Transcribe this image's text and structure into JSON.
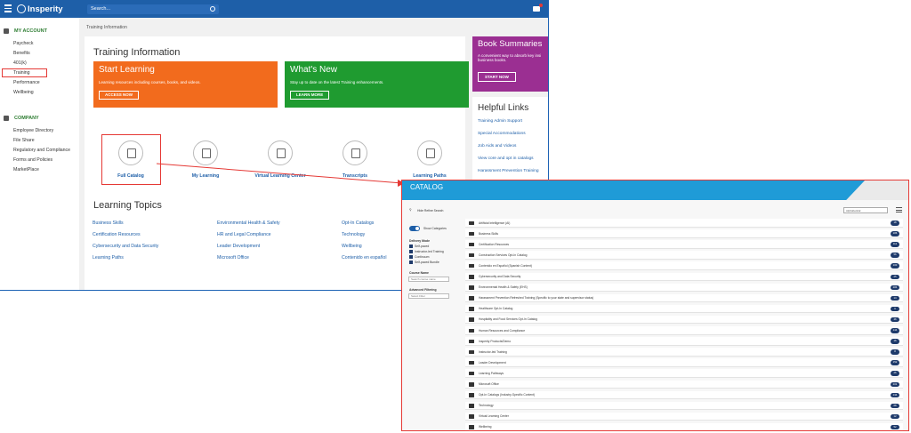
{
  "header": {
    "brand": "Insperity",
    "search_placeholder": "Search..."
  },
  "sidebar": {
    "my_account_title": "MY ACCOUNT",
    "my_account_items": [
      "Paycheck",
      "Benefits",
      "401(k)",
      "Training",
      "Performance",
      "Wellbeing"
    ],
    "company_title": "COMPANY",
    "company_items": [
      "Employee Directory",
      "File Share",
      "Regulatory and Compliance",
      "Forms and Policies",
      "MarketPlace"
    ]
  },
  "breadcrumb": "Training Information",
  "training": {
    "title": "Training Information",
    "start": {
      "title": "Start Learning",
      "desc": "Learning resources including courses, books, and videos.",
      "button": "ACCESS NOW"
    },
    "whats_new": {
      "title": "What's New",
      "desc": "Stay up to date on the latest Training enhancements.",
      "button": "LEARN MORE"
    },
    "quick_links": [
      "Full Catalog",
      "My Learning",
      "Virtual Learning Center",
      "Transcripts",
      "Learning Paths"
    ]
  },
  "book_summaries": {
    "title": "Book Summaries",
    "desc": "A convenient way to absorb key insi business books.",
    "button": "START NOW"
  },
  "helpful_links": {
    "title": "Helpful Links",
    "items": [
      "Training Admin Support",
      "Special Accommodations",
      "Job Aids and Videos",
      "View core and opt in catalogs",
      "Harassment Prevention Training"
    ]
  },
  "learning_topics": {
    "title": "Learning Topics",
    "col1": [
      "Business Skills",
      "Certification Resources",
      "Cybersecurity and Data Security",
      "Learning Paths"
    ],
    "col2": [
      "Environmental Health & Safety",
      "HR and Legal Compliance",
      "Leader Development",
      "Microsoft Office"
    ],
    "col3": [
      "Opt-In Catalogs",
      "Technology",
      "Wellbeing",
      "Contenido en español"
    ]
  },
  "catalog": {
    "title": "CATALOG",
    "hide_refine": "Hide Refine Search",
    "show_categories": "Show Categories",
    "delivery_mode_title": "Delivery Mode",
    "delivery_modes": [
      "Self-paced",
      "Instructor-led Training",
      "Continuum",
      "Self-paced Bundle"
    ],
    "course_name_title": "Course Name",
    "course_name_placeholder": "Search course name",
    "advanced_title": "Advanced Filtering",
    "advanced_value": "Select Filter",
    "sort_value": "Alphabetical",
    "categories": [
      {
        "name": "Artificial Intelligence (AI)",
        "count": "18"
      },
      {
        "name": "Business Skills",
        "count": "186"
      },
      {
        "name": "Certification Resources",
        "count": "112"
      },
      {
        "name": "Construction Services Opt-In Catalog",
        "count": "56"
      },
      {
        "name": "Contenido en Español (Spanish Content)",
        "count": "100"
      },
      {
        "name": "Cybersecurity and Data Security",
        "count": "25"
      },
      {
        "name": "Environmental Health & Safety (EHS)",
        "count": "284"
      },
      {
        "name": "Harassment Prevention Refreshed Training (Specific to your state and supervisor status)",
        "count": "14"
      },
      {
        "name": "Healthcare Opt-In Catalog",
        "count": "6"
      },
      {
        "name": "Hospitality and Food Services Opt-In Catalog",
        "count": "46"
      },
      {
        "name": "Human Resources and Compliance",
        "count": "144"
      },
      {
        "name": "Insperity Products/Demo",
        "count": "16"
      },
      {
        "name": "Instructor-led Training",
        "count": "8"
      },
      {
        "name": "Leader Development",
        "count": "152"
      },
      {
        "name": "Learning Pathways",
        "count": "26"
      },
      {
        "name": "Microsoft Office",
        "count": "201"
      },
      {
        "name": "Opt-In Catalogs (Industry-Specific Content)",
        "count": "134"
      },
      {
        "name": "Technology",
        "count": "68"
      },
      {
        "name": "Virtual Learning Center",
        "count": "12"
      },
      {
        "name": "Wellbeing",
        "count": "52"
      }
    ]
  }
}
